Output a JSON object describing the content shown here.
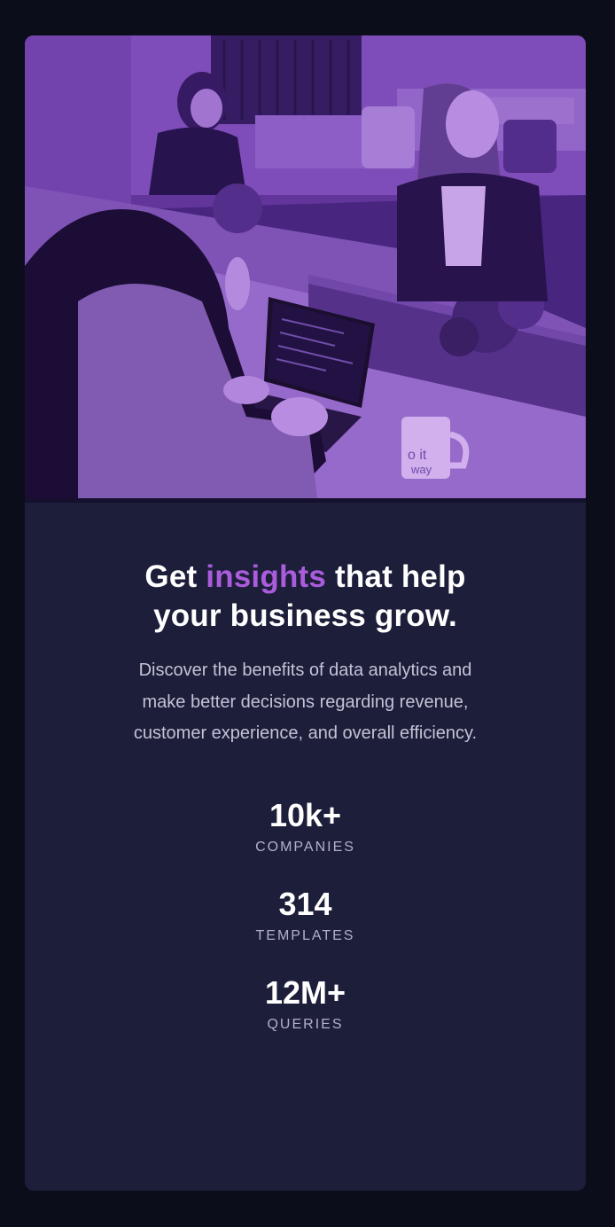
{
  "hero": {
    "mug_text_line1": "o it",
    "mug_text_line2": "way"
  },
  "headline": {
    "before": "Get ",
    "accent": "insights",
    "after": " that help your business grow."
  },
  "description": "Discover the benefits of data analytics and make better decisions regarding revenue, customer experience, and overall efficiency.",
  "stats": [
    {
      "value": "10k+",
      "label": "COMPANIES"
    },
    {
      "value": "314",
      "label": "TEMPLATES"
    },
    {
      "value": "12M+",
      "label": "QUERIES"
    }
  ],
  "colors": {
    "page_background": "#0b0e1a",
    "card_background": "#1c1e3a",
    "accent": "#aa5cdb",
    "heading": "#ffffff",
    "body_text": "#c4c3d6",
    "label_text": "#b2b1c8"
  }
}
